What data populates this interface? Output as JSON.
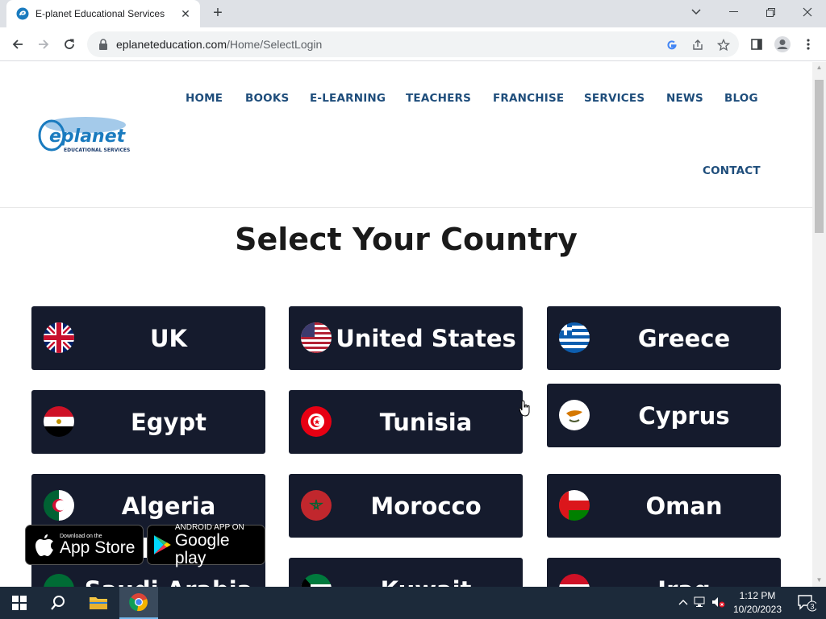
{
  "browser": {
    "tab_title": "E-planet Educational Services",
    "url_host": "eplaneteducation.com",
    "url_path": "/Home/SelectLogin"
  },
  "nav": {
    "items": [
      "HOME",
      "BOOKS",
      "E-LEARNING",
      "TEACHERS",
      "FRANCHISE",
      "SERVICES",
      "NEWS",
      "BLOG"
    ],
    "contact": "CONTACT"
  },
  "logo": {
    "word": "eplanet",
    "tagline": "EDUCATIONAL SERVICES"
  },
  "heading": "Select Your Country",
  "countries": [
    {
      "name": "UK",
      "flag": "uk-flag"
    },
    {
      "name": "United States",
      "flag": "us-flag"
    },
    {
      "name": "Greece",
      "flag": "greece-flag"
    },
    {
      "name": "Egypt",
      "flag": "egypt-flag"
    },
    {
      "name": "Tunisia",
      "flag": "tunisia-flag"
    },
    {
      "name": "Cyprus",
      "flag": "cyprus-flag"
    },
    {
      "name": "Algeria",
      "flag": "algeria-flag"
    },
    {
      "name": "Morocco",
      "flag": "morocco-flag"
    },
    {
      "name": "Oman",
      "flag": "oman-flag"
    },
    {
      "name": "Saudi Arabia",
      "flag": "saudi-flag"
    },
    {
      "name": "Kuwait",
      "flag": "kuwait-flag"
    },
    {
      "name": "Iraq",
      "flag": "iraq-flag"
    }
  ],
  "badges": {
    "apple_small": "Download on the",
    "apple_big": "App Store",
    "google_small": "ANDROID APP ON",
    "google_big": "Google play"
  },
  "taskbar": {
    "time": "1:12 PM",
    "date": "10/20/2023",
    "notifications": "3"
  },
  "colors": {
    "card": "#151b2d",
    "nav": "#1e4d7b"
  }
}
